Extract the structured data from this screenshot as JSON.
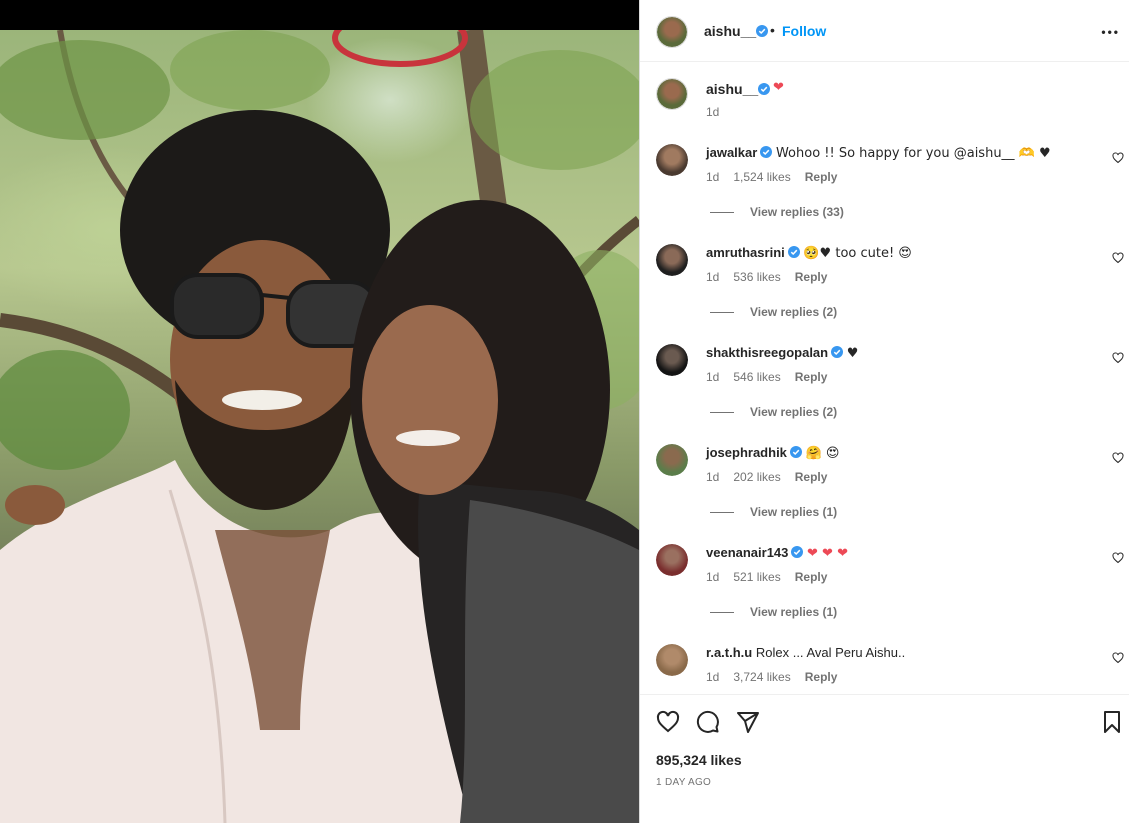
{
  "post": {
    "author": "aishu__",
    "follow_label": "Follow",
    "dot": "•",
    "more_label": "•••",
    "caption_text": "❤",
    "caption_time": "1d",
    "likes": "895,324 likes",
    "time_ago": "1 DAY AGO"
  },
  "comments": [
    {
      "user": "jawalkar",
      "text": "Wohoo !! So happy for you @aishu__ 🫶 ♥",
      "time": "1d",
      "likes": "1,524 likes",
      "reply": "Reply",
      "view_replies": "View replies (33)",
      "avatar_color": "#4a3a30"
    },
    {
      "user": "amruthasrini",
      "text": "🥺♥ too cute! 😍",
      "time": "1d",
      "likes": "536 likes",
      "reply": "Reply",
      "view_replies": "View replies (2)",
      "avatar_color": "#2b2b2b"
    },
    {
      "user": "shakthisreegopalan",
      "text": "♥",
      "time": "1d",
      "likes": "546 likes",
      "reply": "Reply",
      "view_replies": "View replies (2)",
      "avatar_color": "#1e1e1e"
    },
    {
      "user": "josephradhik",
      "text": "🤗 😍",
      "time": "1d",
      "likes": "202 likes",
      "reply": "Reply",
      "view_replies": "View replies (1)",
      "avatar_color": "#5b7d4a"
    },
    {
      "user": "veenanair143",
      "text": "❤ ❤ ❤",
      "time": "1d",
      "likes": "521 likes",
      "reply": "Reply",
      "view_replies": "View replies (1)",
      "avatar_color": "#7a2e2e"
    },
    {
      "user": "r.a.t.h.u",
      "text": "Rolex ... Aval Peru Aishu..",
      "time": "1d",
      "likes": "3,724 likes",
      "reply": "Reply",
      "view_replies": "",
      "avatar_color": "#8a6a4a"
    }
  ],
  "colors": {
    "accent": "#0095f6",
    "verified": "#3897f0",
    "heart": "#ed4956",
    "muted": "#737373"
  },
  "icons": [
    "verified-badge-icon",
    "heart-icon",
    "comment-icon",
    "share-icon",
    "bookmark-icon",
    "more-icon"
  ]
}
